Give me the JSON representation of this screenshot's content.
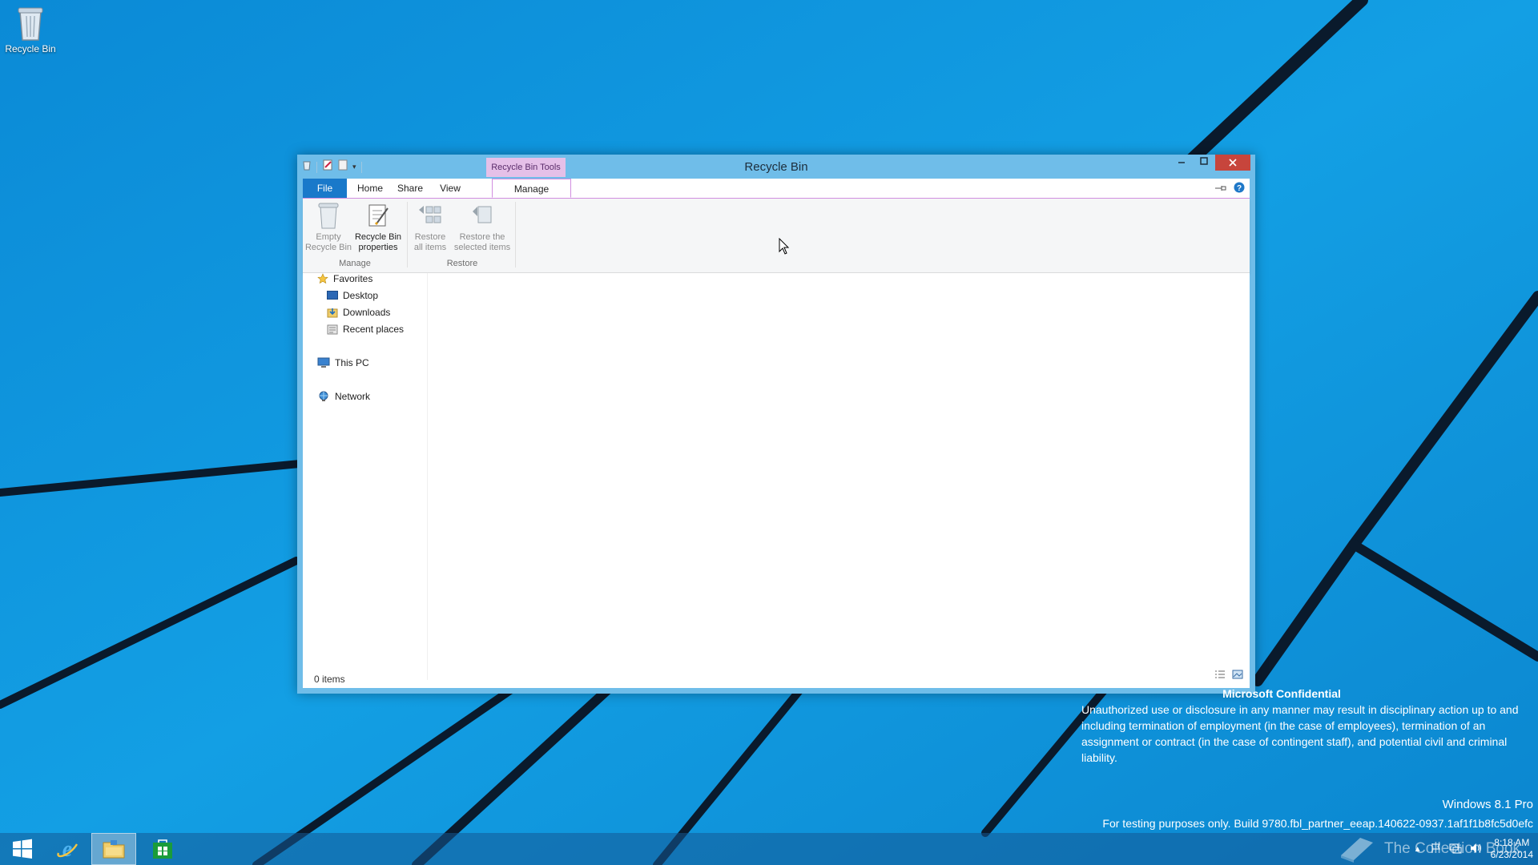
{
  "desktop": {
    "recycle_bin_label": "Recycle Bin"
  },
  "window": {
    "title": "Recycle Bin",
    "context_header": "Recycle Bin Tools",
    "tabs": {
      "file": "File",
      "home": "Home",
      "share": "Share",
      "view": "View",
      "manage": "Manage"
    },
    "ribbon": {
      "empty_recycle_bin": [
        "Empty",
        "Recycle Bin"
      ],
      "recycle_bin_properties": [
        "Recycle Bin",
        "properties"
      ],
      "restore_all_items": [
        "Restore",
        "all items"
      ],
      "restore_selected_items": [
        "Restore the",
        "selected items"
      ],
      "group_manage": "Manage",
      "group_restore": "Restore"
    },
    "nav": {
      "favorites": "Favorites",
      "desktop": "Desktop",
      "downloads": "Downloads",
      "recent_places": "Recent places",
      "this_pc": "This PC",
      "network": "Network"
    },
    "status_text": "0 items"
  },
  "watermark": {
    "confidential_title": "Microsoft Confidential",
    "confidential_body": "Unauthorized use or disclosure in any manner may result in disciplinary action up to and including termination of employment (in the case of employees), termination of an assignment or contract (in the case of contingent staff), and potential civil and criminal liability.",
    "edition": "Windows 8.1 Pro",
    "build": "For testing purposes only. Build 9780.fbl_partner_eeap.140622-0937.1af1f1b8fc5d0efc",
    "overlay_brand": "The Collection Book"
  },
  "taskbar": {
    "time": "8:18 AM",
    "date": "6/23/2014"
  },
  "colors": {
    "accent_blue": "#1979ca",
    "context_tab_pink": "#e5c0e8",
    "close_red": "#c7453c",
    "desktop_blue": "#0a8fd6"
  }
}
